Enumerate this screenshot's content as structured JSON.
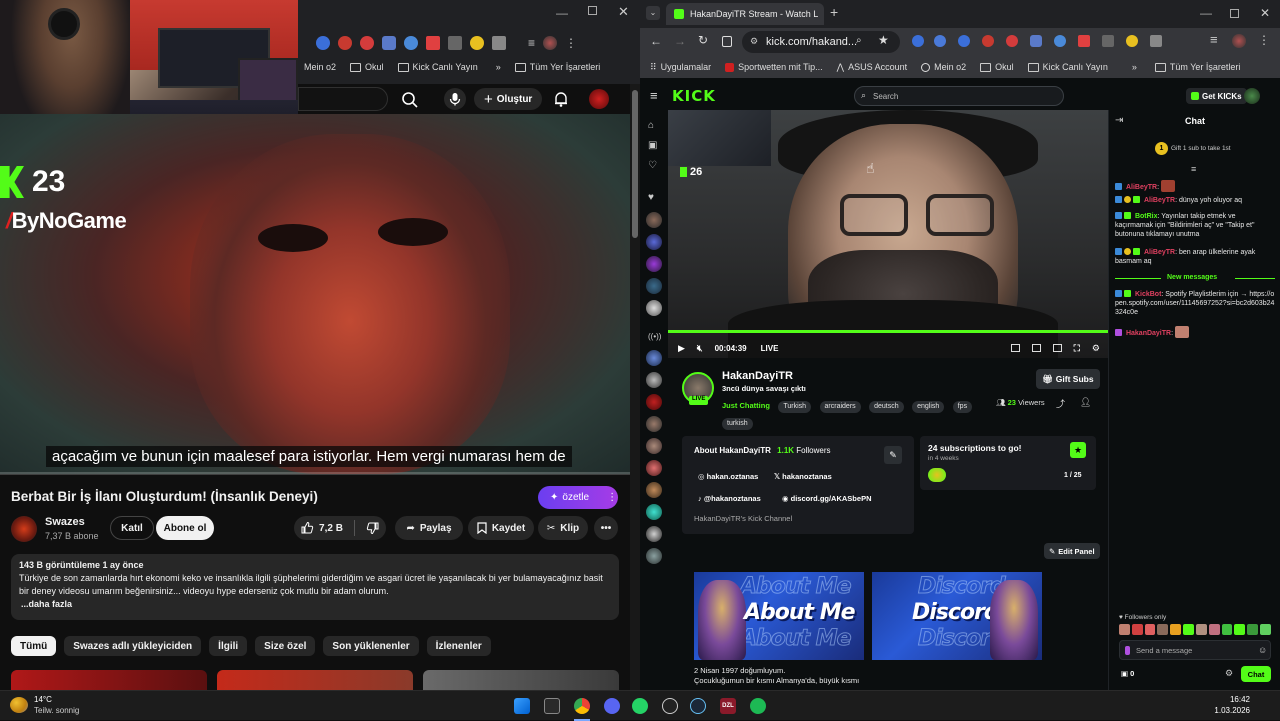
{
  "left_window": {
    "bookmarks": [
      "Mein o2",
      "Okul",
      "Kick Canlı Yayın"
    ],
    "bookmarks_more": "»",
    "all_bookmarks": "Tüm Yer İşaretleri",
    "create_label": "Oluştur",
    "overlay": {
      "kick_viewers": "23",
      "sponsor": "ByNoGame"
    },
    "subtitle": "açacağım ve bunun için maalesef para istiyorlar. Hem vergi numarası hem de",
    "video_title": "Berbat Bir İş İlanı Oluşturdum! (İnsanlık Deneyi)",
    "ozetle_label": "özetle",
    "channel": {
      "name": "Swazes",
      "subs": "7,37 B abone"
    },
    "join_label": "Katıl",
    "subscribe_label": "Abone ol",
    "likes": "7,2 B",
    "share_label": "Paylaş",
    "save_label": "Kaydet",
    "clip_label": "Klip",
    "description": {
      "stats": "143 B görüntüleme  1 ay önce",
      "text": "Türkiye de son zamanlarda hırt ekonomi keko ve insanlıkla ilgili şüphelerimi giderdiğim ve asgari ücret ile yaşanılacak bi yer bulamayacağınız basit bir deney videosu umarım beğenirsiniz... videoyu hype ederseniz çok mutlu bir adam olurum.",
      "more": "...daha fazla"
    },
    "chips": [
      "Tümü",
      "Swazes adlı yükleyiciden",
      "İlgili",
      "Size özel",
      "Son yüklenenler",
      "İzlenenler"
    ]
  },
  "right_window": {
    "tab_title": "HakanDayiTR Stream - Watch L",
    "url": "kick.com/hakand...",
    "bookmarks": [
      "Uygulamalar",
      "Sportwetten mit Tip...",
      "ASUS Account",
      "Mein o2",
      "Okul",
      "Kick Canlı Yayın"
    ],
    "bookmarks_more": "»",
    "all_bookmarks": "Tüm Yer İşaretleri",
    "logo": "KICK",
    "search_placeholder": "Search",
    "get_kicks": "Get KICKs",
    "player": {
      "inset_viewers": "26",
      "time": "00:04:39",
      "live": "LIVE"
    },
    "streamer": {
      "name": "HakanDayiTR",
      "stream_title": "3ncü dünya savaşı çıktı",
      "category": "Just Chatting",
      "tags": [
        "Turkish",
        "arcraiders",
        "deutsch",
        "english",
        "fps",
        "turkish"
      ],
      "live_badge": "LIVE",
      "viewers": "23",
      "viewers_label": "Viewers"
    },
    "gift_subs_label": "Gift Subs",
    "about": {
      "title": "About HakanDayiTR",
      "followers": "1.1K",
      "followers_label": "Followers",
      "instagram": "hakan.oztanas",
      "x": "hakanoztanas",
      "tiktok": "@hakanoztanas",
      "discord": "discord.gg/AKASbePN",
      "channel_desc": "HakanDayiTR's Kick Channel"
    },
    "subs_goal": {
      "title": "24 subscriptions to go!",
      "sub": "in 4 weeks",
      "count": "1 / 25"
    },
    "edit_panel_label": "Edit Panel",
    "panels": [
      {
        "label": "About Me"
      },
      {
        "label": "Discord"
      }
    ],
    "bio": [
      "2 Nisan 1997 doğumluyum.",
      "Çocukluğumun bir kısmı Almanya'da, büyük kısmı"
    ],
    "chat": {
      "title": "Chat",
      "gift_prompt": "Gift 1 sub to take 1st",
      "messages": [
        {
          "user": "AliBeyTR",
          "text": ""
        },
        {
          "user": "AliBeyTR",
          "text": "dünya yoh oluyor aq"
        },
        {
          "user": "BotRix",
          "text": "Yayınları takip etmek ve kaçırmamak için \"Bildirimleri aç\" ve \"Takip et\" butonuna tıklamayı unutma"
        },
        {
          "user": "AliBeyTR",
          "text": "ben arap ülkelerine ayak basmam aq"
        },
        {
          "user": "KickBot",
          "text": "Spotify Playlistlerim için → https://open.spotify.com/user/11145697252?si=bc2d603b24324c0e"
        },
        {
          "user": "HakanDayiTR",
          "text": ""
        }
      ],
      "new_messages": "New messages",
      "followers_only": "Followers only",
      "input_placeholder": "Send a message",
      "points": "0",
      "send_label": "Chat"
    }
  },
  "taskbar": {
    "weather_temp": "14°C",
    "weather_desc": "Teilw. sonnig",
    "time": "16:42",
    "date": "1.03.2026"
  },
  "colors": {
    "kick_green": "#53fc18",
    "yt_bg": "#0f0f0f",
    "ozetle_from": "#6b3ef0",
    "ozetle_to": "#a63ce6"
  }
}
